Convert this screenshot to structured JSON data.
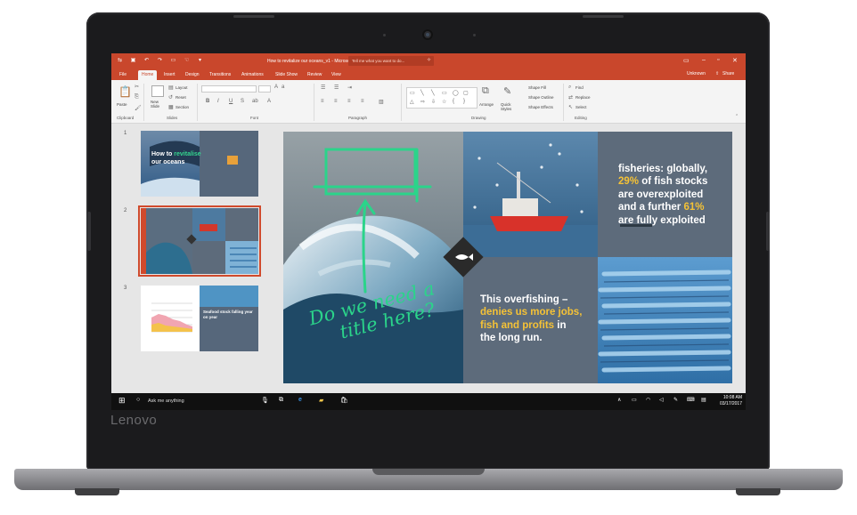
{
  "device": {
    "brand": "Lenovo"
  },
  "window": {
    "title": "How to revitalize our oceans_v1 - Microsoft PowerPoint Preview",
    "tell_me": "Tell me what you want to do...",
    "user": "Unknown",
    "share": "Share"
  },
  "ribbon": {
    "tabs": [
      "File",
      "Home",
      "Insert",
      "Design",
      "Transitions",
      "Animations",
      "Slide Show",
      "Review",
      "View"
    ],
    "active_tab": "Home",
    "paste": "Paste",
    "new_slide": "New Slide",
    "layout": "Layout",
    "reset": "Reset",
    "section": "Section",
    "arrange": "Arrange",
    "quick_styles": "Quick Styles",
    "shape_fill": "Shape Fill",
    "shape_outline": "Shape Outline",
    "shape_effects": "Shape Effects",
    "find": "Find",
    "replace": "Replace",
    "select": "Select",
    "groups": [
      "Clipboard",
      "Slides",
      "Font",
      "Paragraph",
      "Drawing",
      "Editing"
    ]
  },
  "thumbnails": [
    {
      "number": "1",
      "title_a": "How to ",
      "title_b": "revitalise",
      "title_c": "our oceans"
    },
    {
      "number": "2"
    },
    {
      "number": "3",
      "caption": "Seafood stock falling year on year"
    }
  ],
  "slide": {
    "annotation_line1": "Do we need a",
    "annotation_line2": "title here?",
    "fact1_line1": "fisheries: globally,",
    "fact1_line2a": "29%",
    "fact1_line2b": " of fish stocks",
    "fact1_line3": "are overexploited",
    "fact1_line4a": "and a further ",
    "fact1_line4b": "61%",
    "fact1_line5": "are fully exploited",
    "fact2_line1": "This  overfishing –",
    "fact2_line2": "denies us more jobs,",
    "fact2_line3": "fish and profits",
    "fact2_line3b": " in",
    "fact2_line4": "the long run."
  },
  "taskbar": {
    "search": "Ask me anything",
    "time": "10:08 AM",
    "date": "03/17/2017"
  },
  "colors": {
    "accent": "#c9472c",
    "slide_panel": "#5d6b7b",
    "highlight": "#f5c236",
    "marker": "#2bd48a"
  }
}
